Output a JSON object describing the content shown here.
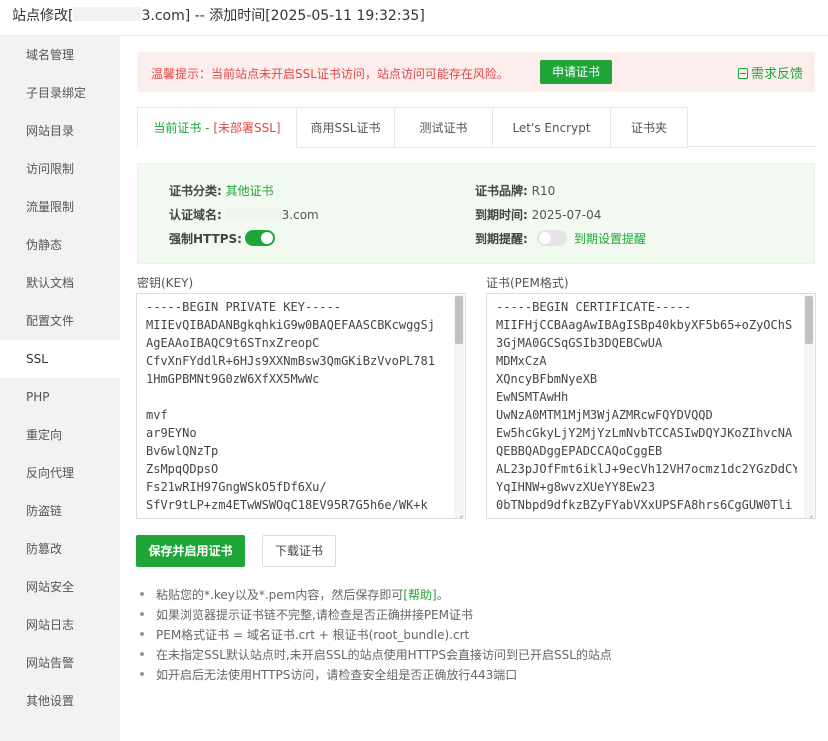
{
  "titlebar": {
    "prefix": "站点修改[",
    "suffix": "3.com] -- 添加时间[2025-05-11 19:32:35]"
  },
  "sidebar": {
    "items": [
      "域名管理",
      "子目录绑定",
      "网站目录",
      "访问限制",
      "流量限制",
      "伪静态",
      "默认文档",
      "配置文件",
      "SSL",
      "PHP",
      "重定向",
      "反向代理",
      "防盗链",
      "防篡改",
      "网站安全",
      "网站日志",
      "网站告警",
      "其他设置"
    ],
    "active": "SSL"
  },
  "alert": {
    "message": "温馨提示：当前站点未开启SSL证书访问，站点访问可能存在风险。",
    "apply_label": "申请证书",
    "feedback_label": "需求反馈"
  },
  "tabs": {
    "current_main": "当前证书 - ",
    "current_status": "[未部署SSL]",
    "commercial": "商用SSL证书",
    "test": "测试证书",
    "letsencrypt": "Let's Encrypt",
    "folder": "证书夹"
  },
  "info": {
    "category_label": "证书分类:",
    "category_value": "其他证书",
    "brand_label": "证书品牌:",
    "brand_value": "R10",
    "domain_label": "认证域名:",
    "domain_value": "3.com",
    "expire_label": "到期时间:",
    "expire_value": "2025-07-04",
    "https_label": "强制HTTPS:",
    "https_enabled": true,
    "remind_label": "到期提醒:",
    "remind_enabled": false,
    "remind_link": "到期设置提醒"
  },
  "key": {
    "label": "密钥(KEY)",
    "lines": [
      "-----BEGIN PRIVATE KEY-----",
      "MIIEvQIBADANBgkqhkiG9w0BAQEFAASCBKcwggSj",
      "AgEAAoIBAQC9t6STnxZreopC",
      "CfvXnFYddlR+6HJs9XXNmBsw3QmGKiBzVvoPL781",
      "1HmGPBMNt9G0zW6XfXX5MwWc",
      "",
      "mvf",
      "ar9EYNo",
      "Bv6wlQNzTp",
      "ZsMpqQDpsO",
      "Fs21wRIH97GngWSkO5fDf6Xu/",
      "SfVr9tLP+zm4ETwWSWOqC18EV95R7G5h6e/WK+k"
    ]
  },
  "cert": {
    "label": "证书(PEM格式)",
    "lines": [
      "-----BEGIN CERTIFICATE-----",
      "MIIFHjCCBAagAwIBAgISBp40kbyXF5b65+oZyOChS",
      "3GjMA0GCSqGSIb3DQEBCwUA",
      "MDMxCzA",
      "XQncyBFbmNyeXB",
      "EwNSMTAwHh",
      "UwNzA0MTM1MjM3WjAZMRcwFQYDVQQD",
      "Ew5hcGkyLjY2MjYzLmNvbTCCASIwDQYJKoZIhvcNA",
      "QEBBQADggEPADCCAQoCggEB",
      "AL23pJOfFmt6iklJ+9ecVh12VH7ocmz1dc2YGzDdCY",
      "YqIHNW+g8wvzXUeYY8Ew23",
      "0bTNbpd9dfkzBZyFYabVXxUPSFA8hrs6CgGUW0Tli"
    ]
  },
  "actions": {
    "save_label": "保存并启用证书",
    "download_label": "下载证书"
  },
  "tips": {
    "t1_text": "粘贴您的*.key以及*.pem内容，然后保存即可",
    "t1_link": "[帮助]",
    "t1_end": "。",
    "t2": "如果浏览器提示证书链不完整,请检查是否正确拼接PEM证书",
    "t3": "PEM格式证书 = 域名证书.crt + 根证书(root_bundle).crt",
    "t4": "在未指定SSL默认站点时,未开启SSL的站点使用HTTPS会直接访问到已开启SSL的站点",
    "t5": "如开启后无法使用HTTPS访问，请检查安全组是否正确放行443端口"
  }
}
